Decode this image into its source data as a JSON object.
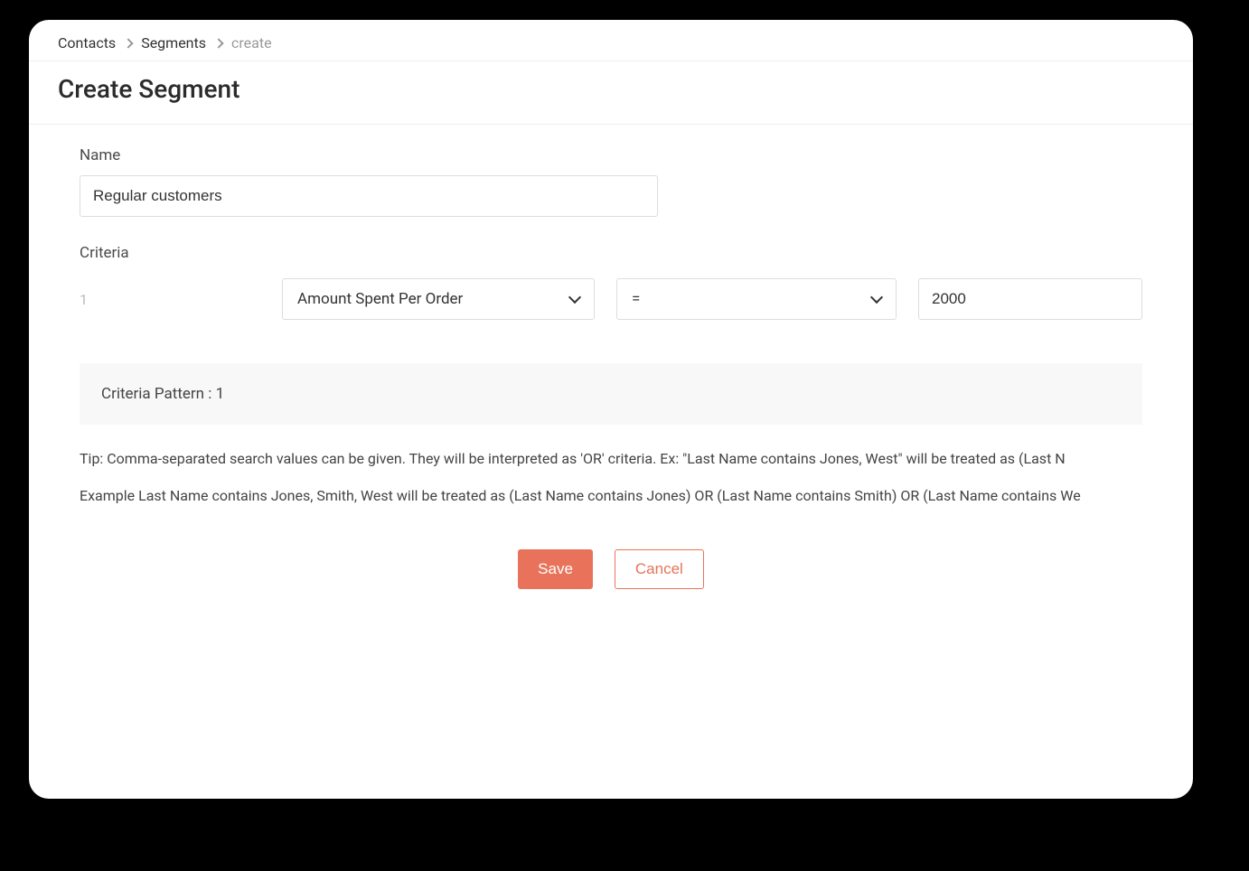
{
  "breadcrumb": {
    "items": [
      "Contacts",
      "Segments",
      "create"
    ]
  },
  "header": {
    "title": "Create Segment"
  },
  "form": {
    "name_label": "Name",
    "name_value": "Regular customers",
    "criteria_label": "Criteria",
    "rows": [
      {
        "index": "1",
        "field": "Amount Spent Per Order",
        "operator": "=",
        "value": "2000"
      }
    ],
    "pattern_label": "Criteria Pattern : 1",
    "tip_text": "Tip: Comma-separated search values can be given. They will be interpreted as 'OR' criteria. Ex: \"Last Name contains Jones, West\" will be treated as (Last N",
    "example_text": "Example  Last Name contains Jones, Smith, West will be treated as (Last Name contains Jones) OR (Last Name contains Smith) OR (Last Name contains We"
  },
  "actions": {
    "save_label": "Save",
    "cancel_label": "Cancel"
  }
}
